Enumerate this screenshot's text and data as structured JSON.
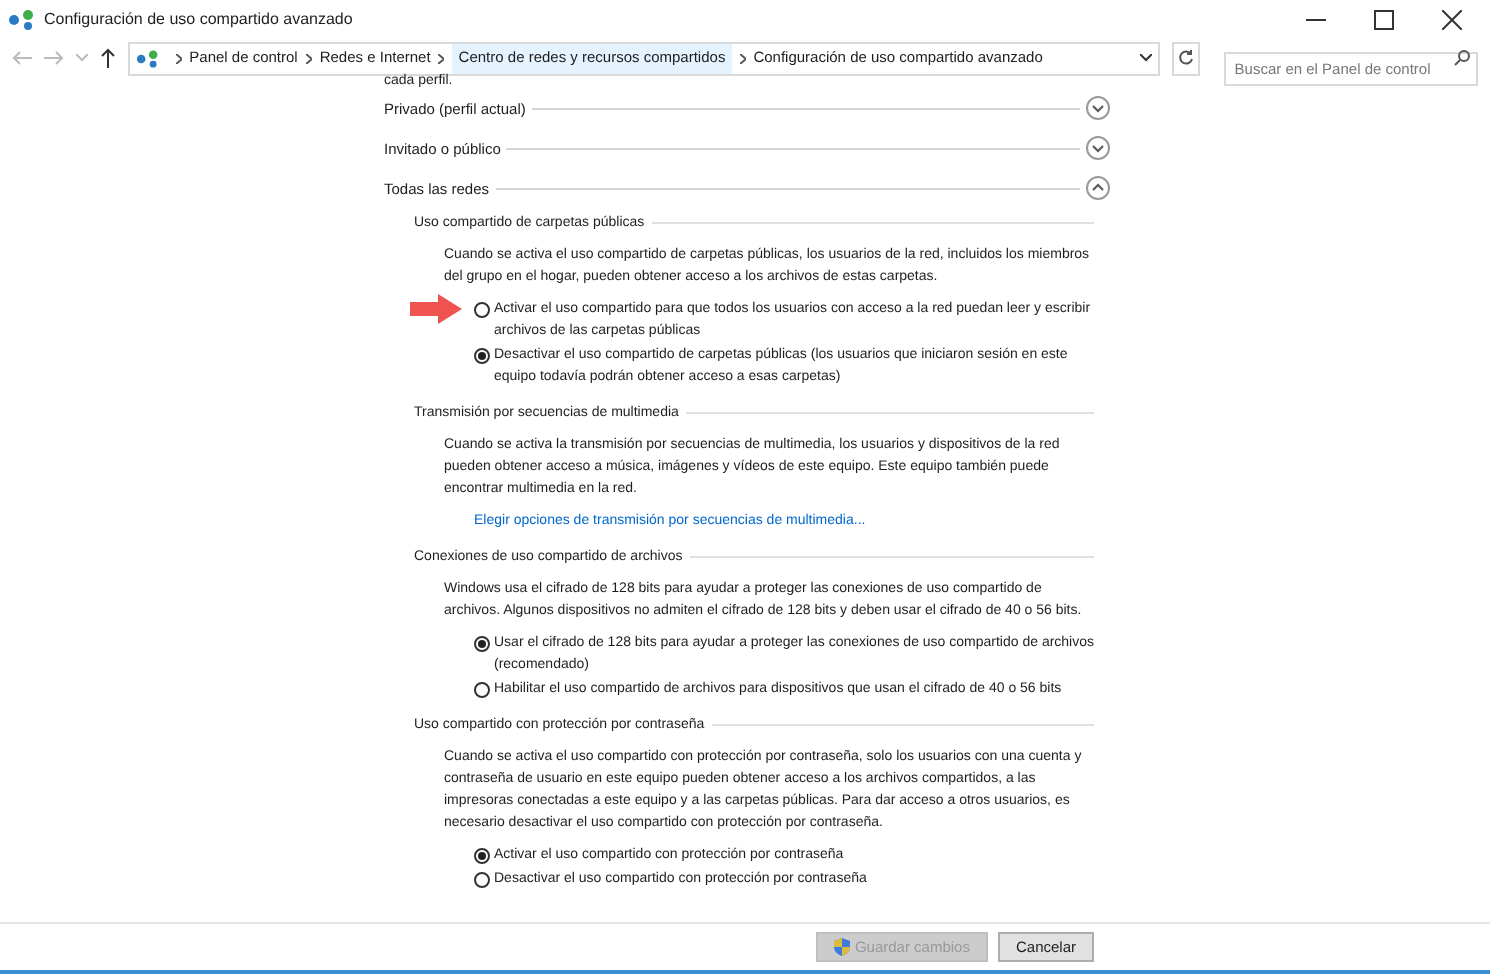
{
  "window": {
    "title": "Configuración de uso compartido avanzado"
  },
  "address_bar": {
    "breadcrumbs": [
      {
        "label": "Panel de control",
        "highlighted": false
      },
      {
        "label": "Redes e Internet",
        "highlighted": false
      },
      {
        "label": "Centro de redes y recursos compartidos",
        "highlighted": true
      },
      {
        "label": "Configuración de uso compartido avanzado",
        "highlighted": false
      }
    ],
    "search": {
      "placeholder": "Buscar en el Panel de control"
    }
  },
  "intro_fragment": "cada perfil.",
  "profiles": [
    {
      "label": "Privado (perfil actual)",
      "expanded": false
    },
    {
      "label": "Invitado o público",
      "expanded": false
    },
    {
      "label": "Todas las redes",
      "expanded": true,
      "sections": [
        {
          "title": "Uso compartido de carpetas públicas",
          "description": "Cuando se activa el uso compartido de carpetas públicas, los usuarios de la red, incluidos los miembros del grupo en el hogar, pueden obtener acceso a los archivos de estas carpetas.",
          "items": [
            {
              "kind": "radio",
              "label": "Activar el uso compartido para que todos los usuarios con acceso a la red puedan leer y escribir archivos de las carpetas públicas",
              "selected": false,
              "pointed": true
            },
            {
              "kind": "radio",
              "label": "Desactivar el uso compartido de carpetas públicas (los usuarios que iniciaron sesión en este equipo todavía podrán obtener acceso a esas carpetas)",
              "selected": true,
              "pointed": false
            }
          ]
        },
        {
          "title": "Transmisión por secuencias de multimedia",
          "description": "Cuando se activa la transmisión por secuencias de multimedia, los usuarios y dispositivos de la red pueden obtener acceso a música, imágenes y vídeos de este equipo. Este equipo también puede encontrar multimedia en la red.",
          "items": [
            {
              "kind": "link",
              "label": "Elegir opciones de transmisión por secuencias de multimedia..."
            }
          ]
        },
        {
          "title": "Conexiones de uso compartido de archivos",
          "description": "Windows usa el cifrado de 128 bits para ayudar a proteger las conexiones de uso compartido de archivos. Algunos dispositivos no admiten el cifrado de 128 bits y deben usar el cifrado de 40 o 56 bits.",
          "items": [
            {
              "kind": "radio",
              "label": "Usar el cifrado de 128 bits para ayudar a proteger las conexiones de uso compartido de archivos (recomendado)",
              "selected": true,
              "pointed": false
            },
            {
              "kind": "radio",
              "label": "Habilitar el uso compartido de archivos para dispositivos que usan el cifrado de 40 o 56 bits",
              "selected": false,
              "pointed": false
            }
          ]
        },
        {
          "title": "Uso compartido con protección por contraseña",
          "description": "Cuando se activa el uso compartido con protección por contraseña, solo los usuarios con una cuenta y contraseña de usuario en este equipo pueden obtener acceso a los archivos compartidos, a las impresoras conectadas a este equipo y a las carpetas públicas. Para dar acceso a otros usuarios, es necesario desactivar el uso compartido con protección por contraseña.",
          "items": [
            {
              "kind": "radio",
              "label": "Activar el uso compartido con protección por contraseña",
              "selected": true,
              "pointed": false
            },
            {
              "kind": "radio",
              "label": "Desactivar el uso compartido con protección por contraseña",
              "selected": false,
              "pointed": false
            }
          ]
        }
      ]
    }
  ],
  "buttons": [
    {
      "label": "Guardar cambios",
      "disabled": true,
      "shield": true
    },
    {
      "label": "Cancelar",
      "disabled": false,
      "shield": false
    }
  ]
}
